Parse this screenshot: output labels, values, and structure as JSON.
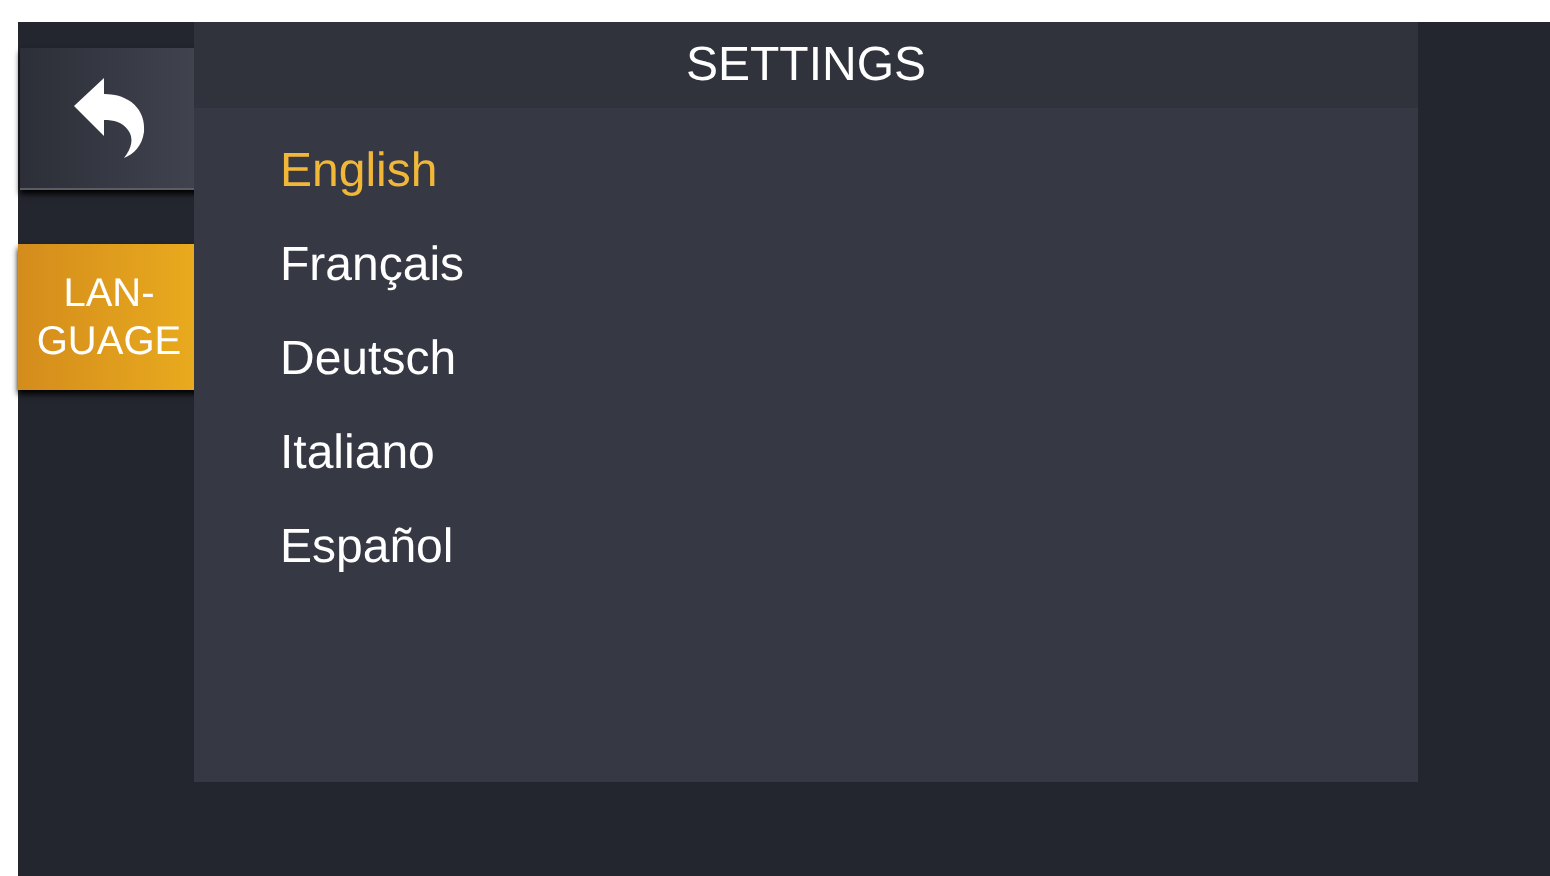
{
  "title": "SETTINGS",
  "side_tabs": [
    {
      "label": "LAN-\nGUAGE",
      "selected": true
    }
  ],
  "languages": [
    {
      "label": "English",
      "selected": true
    },
    {
      "label": "Français",
      "selected": false
    },
    {
      "label": "Deutsch",
      "selected": false
    },
    {
      "label": "Italiano",
      "selected": false
    },
    {
      "label": "Español",
      "selected": false
    }
  ]
}
